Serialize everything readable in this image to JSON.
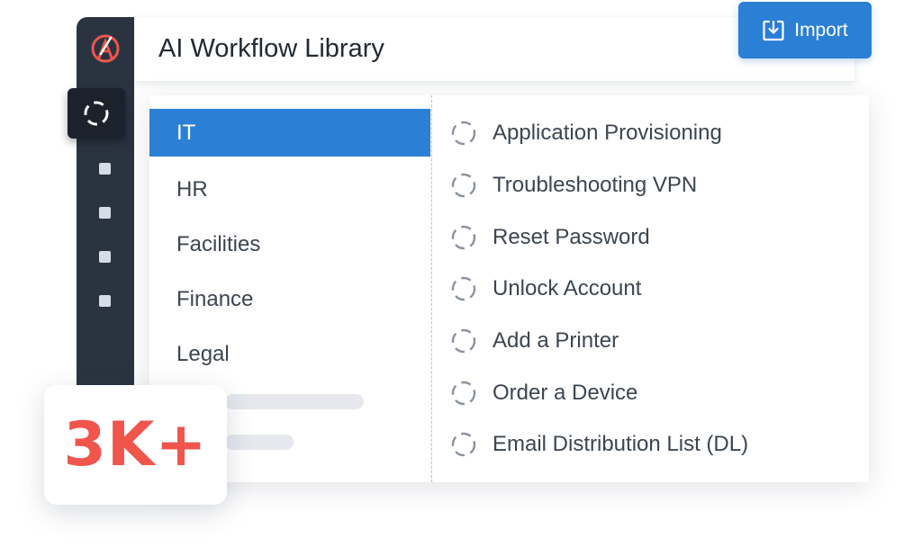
{
  "app": {
    "title": "AI Workflow Library"
  },
  "toolbar": {
    "import_label": "Import"
  },
  "categories": [
    {
      "label": "IT",
      "active": true
    },
    {
      "label": "HR",
      "active": false
    },
    {
      "label": "Facilities",
      "active": false
    },
    {
      "label": "Finance",
      "active": false
    },
    {
      "label": "Legal",
      "active": false
    }
  ],
  "workflows": [
    {
      "label": "Application Provisioning"
    },
    {
      "label": "Troubleshooting VPN"
    },
    {
      "label": "Reset Password"
    },
    {
      "label": "Unlock Account"
    },
    {
      "label": "Add a Printer"
    },
    {
      "label": "Order a Device"
    },
    {
      "label": "Email Distribution List (DL)"
    }
  ],
  "stat": {
    "value": "3K+"
  },
  "colors": {
    "accent": "#2b7fd4",
    "sidebar": "#2a3440",
    "stat": "#f0554c"
  },
  "icons": {
    "logo": "compass-logo-icon",
    "active_nav": "workflow-cycle-icon",
    "workflow": "workflow-cycle-icon",
    "import": "download-tray-icon"
  }
}
